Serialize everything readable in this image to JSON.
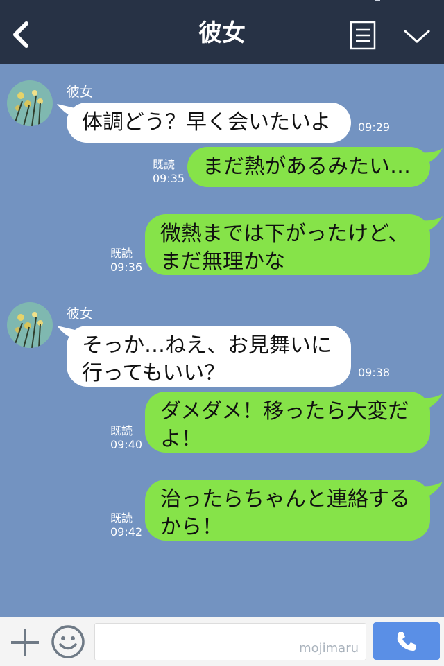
{
  "header": {
    "title": "彼女"
  },
  "contact_name": "彼女",
  "messages": [
    {
      "text": "体調どう？早く会いたいよ",
      "time": "09:29"
    },
    {
      "line1": "まだ熱があるみたい…",
      "read": "既読",
      "time": "09:35"
    },
    {
      "line1": "微熱までは下がったけど、",
      "line2": "まだ無理かな",
      "read": "既読",
      "time": "09:36"
    },
    {
      "line1": "そっか…ねえ、お見舞いに",
      "line2": "行ってもいい？",
      "time": "09:38"
    },
    {
      "line1": "ダメダメ！移ったら大変だ",
      "line2": "よ！",
      "read": "既読",
      "time": "09:40"
    },
    {
      "line1": "治ったらちゃんと連絡する",
      "line2": "から！",
      "read": "既読",
      "time": "09:42"
    }
  ],
  "footer": {
    "watermark": "mojimaru"
  },
  "colors": {
    "header": "#273245",
    "background": "#7393c1",
    "bubble_out": "#86e349",
    "bubble_in": "#ffffff",
    "call_button": "#5a8fe6"
  }
}
